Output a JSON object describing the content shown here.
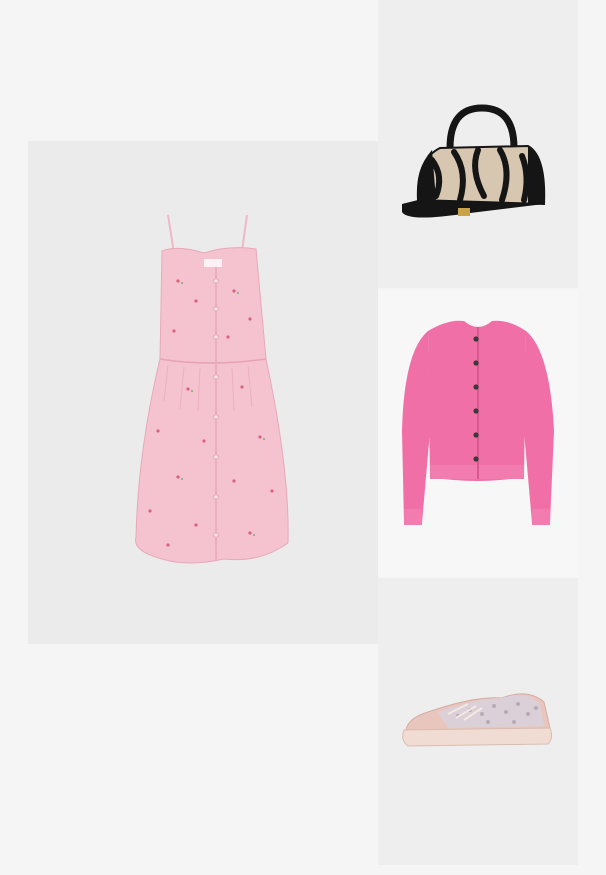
{
  "outfit": {
    "items": [
      {
        "name": "dress",
        "icon": "pink-floral-button-front-mini-dress",
        "bg": "#ebebeb"
      },
      {
        "name": "bag",
        "icon": "zebra-print-top-handle-bag",
        "bg": "#eeeeee"
      },
      {
        "name": "cardigan",
        "icon": "pink-knit-button-cardigan",
        "bg": "#f7f7f7"
      },
      {
        "name": "sneaker",
        "icon": "pink-sequin-low-top-sneaker",
        "bg": "#eeeeee"
      }
    ],
    "colors": {
      "page": "#f5f5f5",
      "dress": "#f4c3cf",
      "cardigan": "#ef6fa6",
      "sneaker": "#e8c6bd",
      "bag_black": "#151515",
      "bag_beige": "#d7c6b0"
    }
  }
}
